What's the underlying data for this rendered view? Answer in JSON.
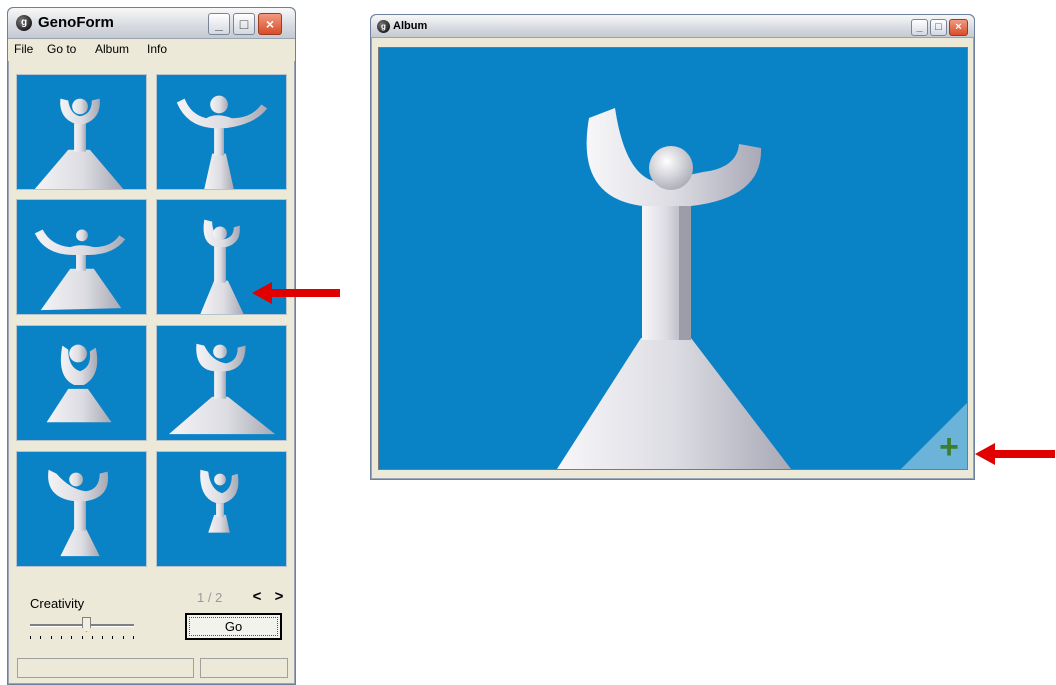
{
  "genoform": {
    "title": "GenoForm",
    "icon": "app-logo-icon",
    "menu": [
      "File",
      "Go to",
      "Album",
      "Info"
    ],
    "thumbnails": [
      {
        "id": "form-1"
      },
      {
        "id": "form-2"
      },
      {
        "id": "form-3"
      },
      {
        "id": "form-4"
      },
      {
        "id": "form-5"
      },
      {
        "id": "form-6"
      },
      {
        "id": "form-7"
      },
      {
        "id": "form-8"
      }
    ],
    "creativity_label": "Creativity",
    "creativity_level": 0.55,
    "page_indicator": "1 / 2",
    "prev_glyph": "<",
    "next_glyph": ">",
    "go_label": "Go",
    "window_buttons": {
      "minimize": "_",
      "maximize": "□",
      "close": "×"
    }
  },
  "album": {
    "title": "Album",
    "add_glyph": "+",
    "window_buttons": {
      "minimize": "_",
      "maximize": "□",
      "close": "×"
    }
  },
  "colors": {
    "viewport_blue": "#0a82c6",
    "annotation_red": "#e00000",
    "add_green": "#3d7e2e"
  },
  "annotations": [
    "arrow-pointing-at-selected-thumbnail",
    "arrow-pointing-at-add-to-album-corner"
  ]
}
